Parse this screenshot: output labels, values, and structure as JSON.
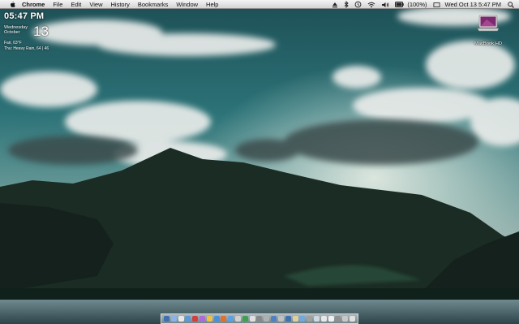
{
  "menubar": {
    "apple_icon": "apple-icon",
    "app_name": "Chrome",
    "menus": [
      "File",
      "Edit",
      "View",
      "History",
      "Bookmarks",
      "Window",
      "Help"
    ],
    "battery_text": "(100%)",
    "datetime": "Wed Oct 13  5:47 PM",
    "status_icons": [
      "eject-icon",
      "bluetooth-icon",
      "time-machine-icon",
      "wifi-icon",
      "volume-icon",
      "battery-icon",
      "user-icon",
      "spotlight-icon"
    ]
  },
  "widget": {
    "time": "05:47 PM",
    "day": "Wednesday",
    "month": "October",
    "date": "13",
    "weather_now": "Fair, 63°F",
    "weather_next": "Thu: Heavy Rain, 64 | 46"
  },
  "desktop": {
    "hd_label": "MacBook HD"
  },
  "dock": {
    "icon_colors": [
      "#3f6fb0",
      "#8ab4e8",
      "#e8e8e8",
      "#5a9ad8",
      "#d04040",
      "#b06ad8",
      "#f0c040",
      "#4a90d8",
      "#e07030",
      "#60a0e0",
      "#d0d0d0",
      "#3fa050",
      "#e0e0e0",
      "#888888",
      "#b0b0b0",
      "#5080c0",
      "#c0c0c0",
      "#4070b0",
      "#e0d0a0",
      "#70a8e0",
      "#a0a0a0",
      "#d0d8e0",
      "#e8e8e8",
      "#f0f0f0",
      "#909090",
      "#c8c8c8",
      "#e0e0e0"
    ]
  }
}
